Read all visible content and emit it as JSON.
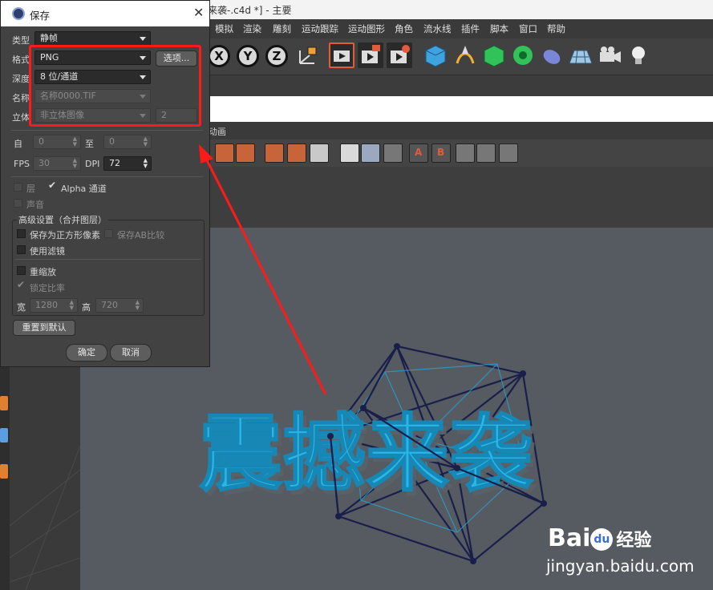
{
  "window": {
    "title": "来袭-.c4d *] - 主要"
  },
  "menubar": {
    "items": [
      "模拟",
      "渲染",
      "雕刻",
      "运动跟踪",
      "运动图形",
      "角色",
      "流水线",
      "插件",
      "脚本",
      "窗口",
      "帮助"
    ]
  },
  "toolbar": {
    "axis_labels": [
      "X",
      "Y",
      "Z"
    ]
  },
  "viewport": {
    "header_label": "动画",
    "scene_text": "震撼来袭"
  },
  "dialog": {
    "title": "保存",
    "type_label": "类型",
    "type_value": "静帧",
    "format_label": "格式",
    "format_value": "PNG",
    "options_button": "选项...",
    "depth_label": "深度",
    "depth_value": "8 位/通道",
    "name_label": "名称",
    "name_value": "名称0000.TIF",
    "stereo_label": "立体",
    "stereo_value": "非立体图像",
    "stereo_count": "2",
    "from_label": "自",
    "from_value": "0",
    "to_label": "至",
    "to_value": "0",
    "fps_label": "FPS",
    "fps_value": "30",
    "dpi_label": "DPI",
    "dpi_value": "72",
    "layer_label": "层",
    "alpha_label": "Alpha 通道",
    "sound_label": "声音",
    "advanced_title": "高级设置（合并图层）",
    "square_pixels_label": "保存为正方形像素",
    "save_ab_label": "保存AB比较",
    "use_filter_label": "使用滤镜",
    "rescale_label": "重缩放",
    "lock_ratio_label": "锁定比率",
    "width_label": "宽",
    "width_value": "1280",
    "height_label": "高",
    "height_value": "720",
    "reset_button": "重置到默认",
    "ok_button": "确定",
    "cancel_button": "取消"
  },
  "watermark": {
    "logo": "Bai",
    "logo_du": "du",
    "logo_cn": "经验",
    "url": "jingyan.baidu.com"
  },
  "colors": {
    "annotation_red": "#ff1a1a",
    "text_cyan": "#29b6e8",
    "wireframe": "#1a1f4a"
  }
}
